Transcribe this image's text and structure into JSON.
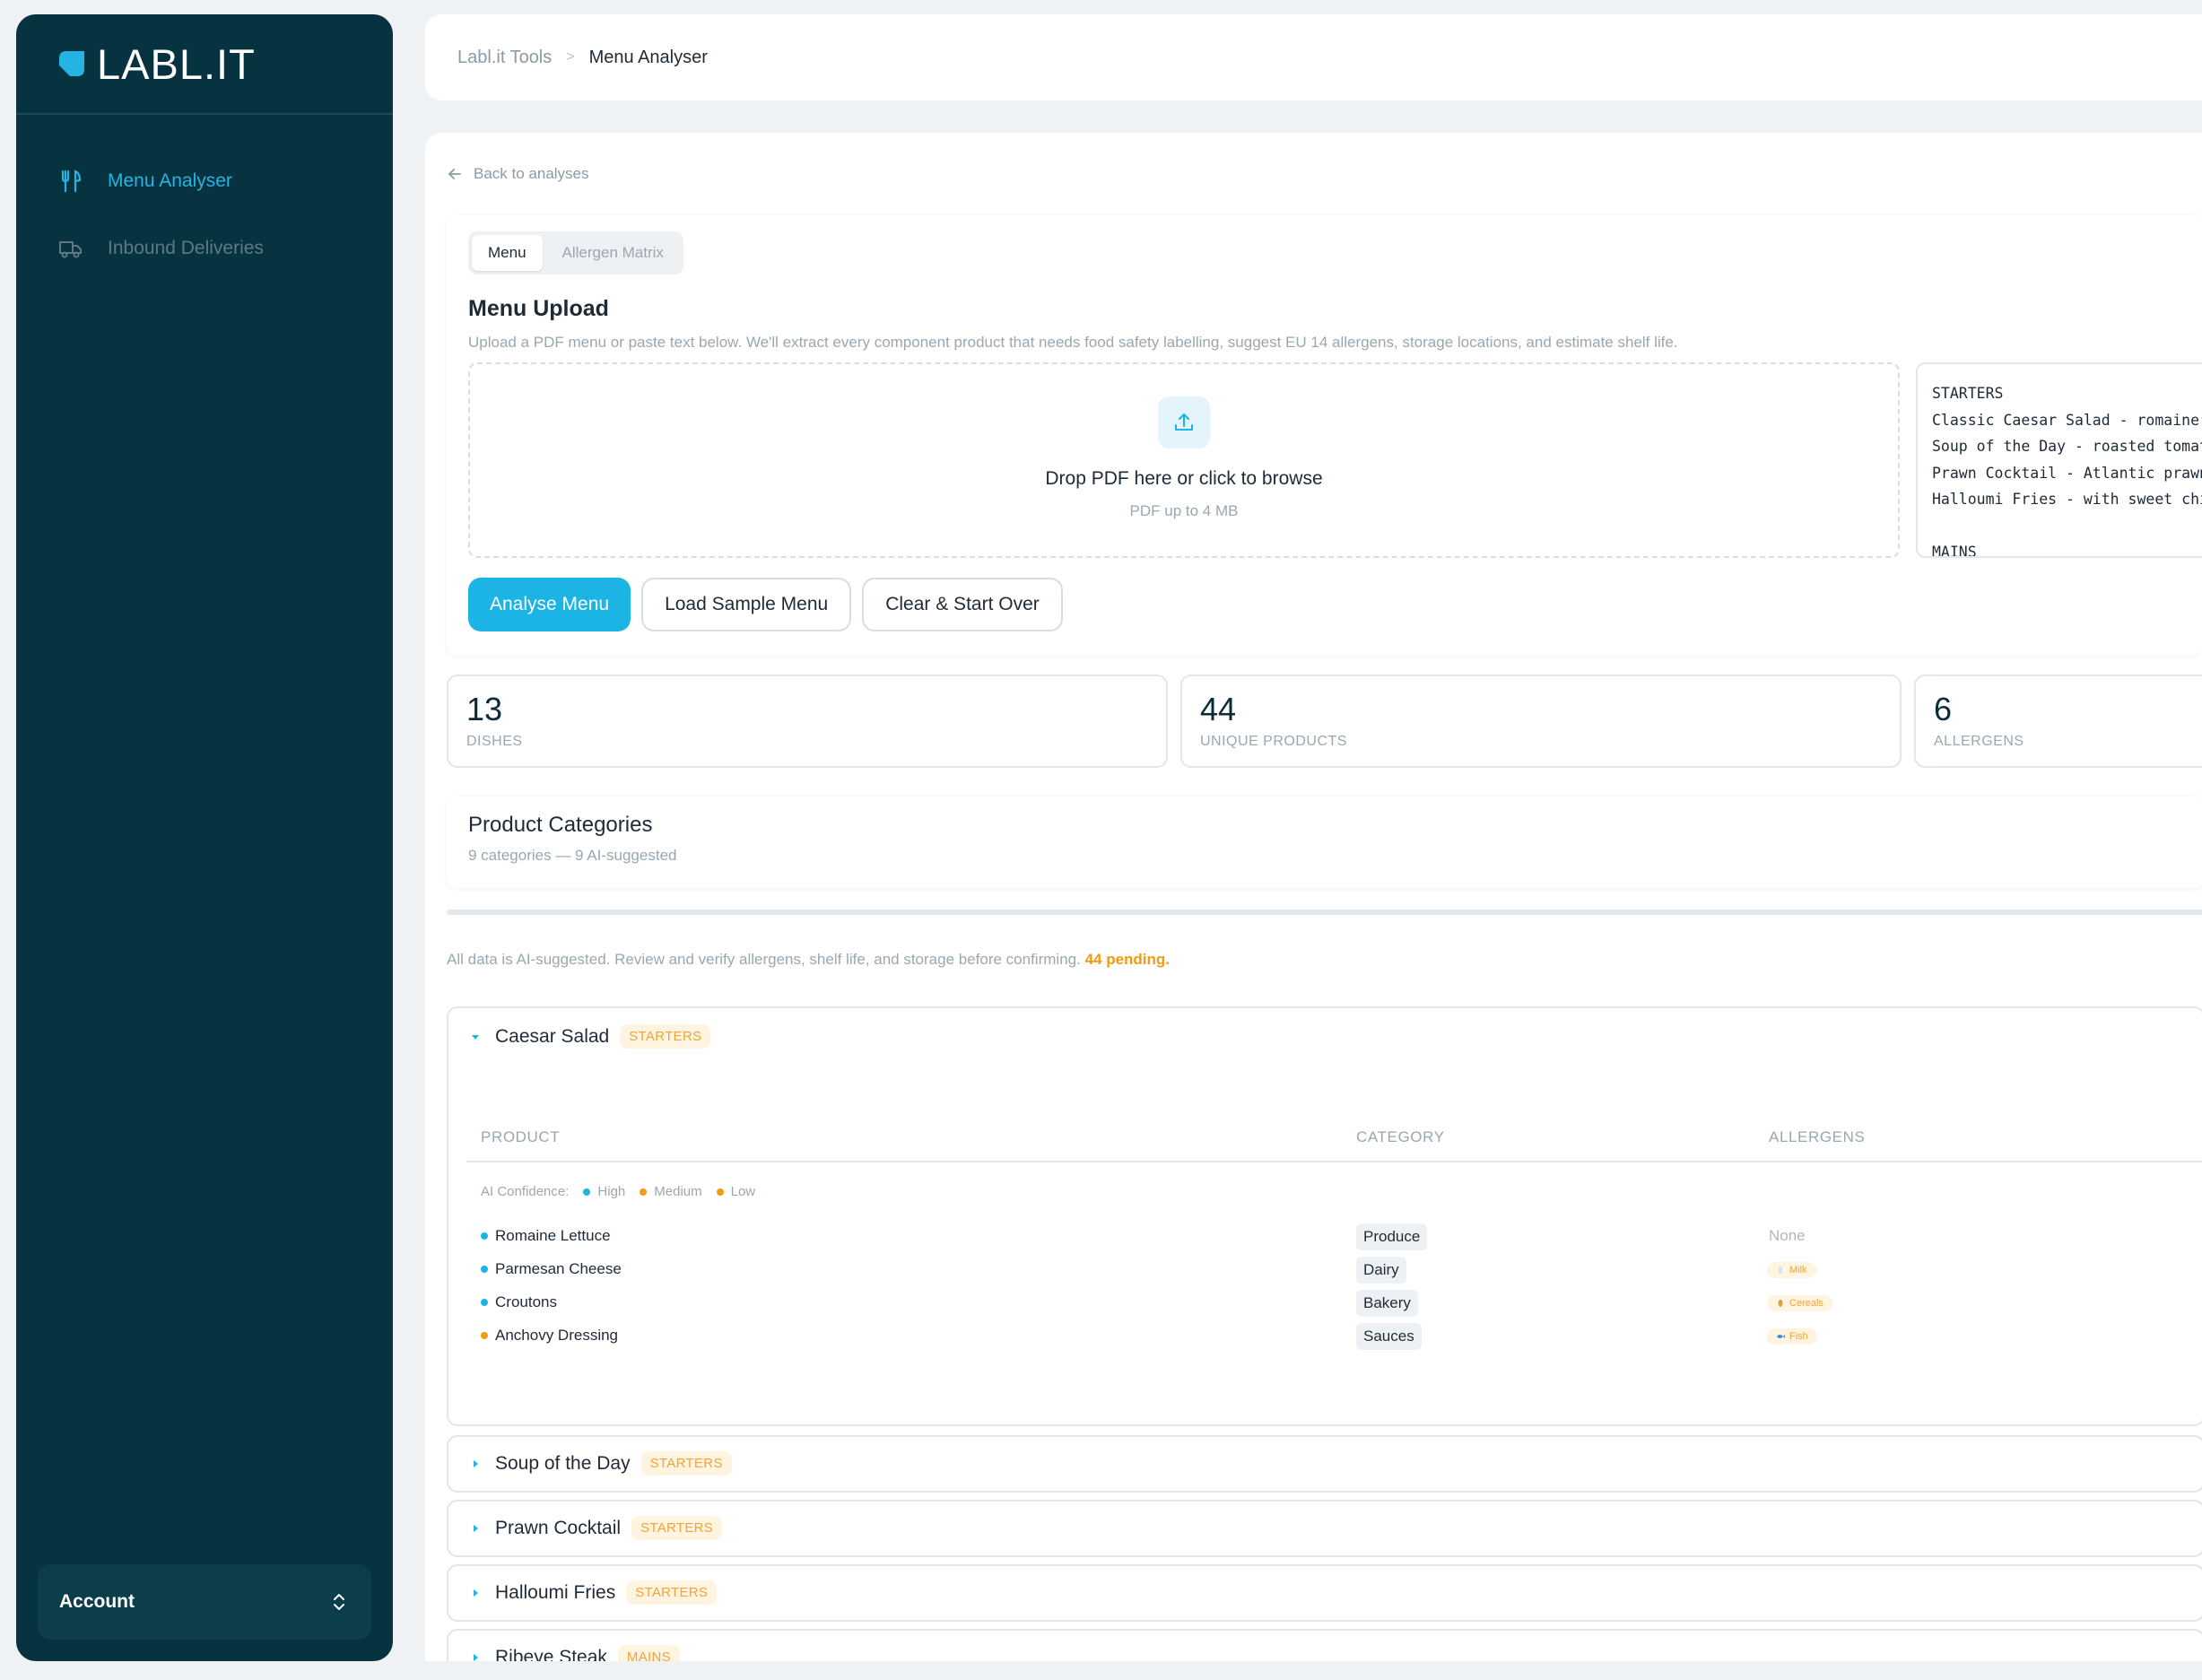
{
  "brand": {
    "name": "LABL.IT",
    "color": "#23b4e3"
  },
  "sidebar": {
    "items": [
      {
        "label": "Menu Analyser",
        "icon": "fork-knife-icon",
        "active": true
      },
      {
        "label": "Inbound Deliveries",
        "icon": "truck-icon",
        "active": false
      }
    ],
    "account_label": "Account"
  },
  "breadcrumb": {
    "root": "Labl.it Tools",
    "separator": ">",
    "current": "Menu Analyser"
  },
  "back_label": "Back to analyses",
  "tabs": [
    {
      "label": "Menu",
      "active": true
    },
    {
      "label": "Allergen Matrix",
      "active": false
    }
  ],
  "upload": {
    "title": "Menu Upload",
    "description": "Upload a PDF menu or paste text below. We'll extract every component product that needs food safety labelling, suggest EU 14 allergens, storage locations, and estimate shelf life.",
    "drop_title": "Drop PDF here or click to browse",
    "drop_sub": "PDF up to 4 MB",
    "menu_text": "STARTERS\nClassic Caesar Salad - romaine,\nSoup of the Day - roasted tomat\nPrawn Cocktail - Atlantic prawn\nHalloumi Fries - with sweet chi\n\nMAINS"
  },
  "buttons": {
    "analyse": "Analyse Menu",
    "load_sample": "Load Sample Menu",
    "clear": "Clear & Start Over"
  },
  "stats": [
    {
      "value": "13",
      "label": "DISHES"
    },
    {
      "value": "44",
      "label": "UNIQUE PRODUCTS"
    },
    {
      "value": "6",
      "label": "ALLERGENS"
    }
  ],
  "categories": {
    "title": "Product Categories",
    "subtitle": "9 categories — 9 AI-suggested"
  },
  "ai_note": {
    "text": "All data is AI-suggested. Review and verify allergens, shelf life, and storage before confirming.",
    "pending": "44 pending."
  },
  "table": {
    "columns": {
      "product": "PRODUCT",
      "category": "CATEGORY",
      "allergens": "ALLERGENS"
    },
    "legend": {
      "label": "AI Confidence:",
      "high": "High",
      "medium": "Medium",
      "low": "Low"
    }
  },
  "dishes": [
    {
      "name": "Caesar Salad",
      "tag": "STARTERS",
      "expanded": true,
      "products": [
        {
          "name": "Romaine Lettuce",
          "confidence": "high",
          "category": "Produce",
          "allergen": "None"
        },
        {
          "name": "Parmesan Cheese",
          "confidence": "high",
          "category": "Dairy",
          "allergen": "Milk"
        },
        {
          "name": "Croutons",
          "confidence": "high",
          "category": "Bakery",
          "allergen": "Cereals"
        },
        {
          "name": "Anchovy Dressing",
          "confidence": "medium",
          "category": "Sauces",
          "allergen": "Fish"
        }
      ]
    },
    {
      "name": "Soup of the Day",
      "tag": "STARTERS",
      "expanded": false
    },
    {
      "name": "Prawn Cocktail",
      "tag": "STARTERS",
      "expanded": false
    },
    {
      "name": "Halloumi Fries",
      "tag": "STARTERS",
      "expanded": false
    },
    {
      "name": "Ribeye Steak",
      "tag": "MAINS",
      "expanded": false
    }
  ],
  "colors": {
    "sidebar_bg": "#07323f",
    "accent": "#1bb4e5",
    "warning": "#f29a12",
    "tag_bg": "#fff4e0"
  }
}
